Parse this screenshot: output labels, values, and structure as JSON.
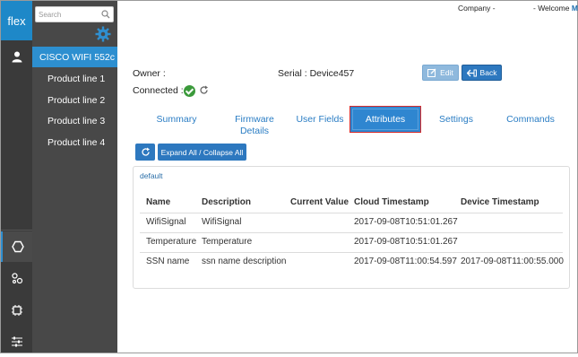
{
  "rail": {
    "logo": "flex",
    "items": [
      "user-icon",
      "hexagon-icon",
      "cog-network-icon",
      "chip-icon",
      "sliders-icon"
    ]
  },
  "sidebar": {
    "search_placeholder": "Search",
    "device": "CISCO WIFI 552c",
    "product_lines": [
      "Product line 1",
      "Product line 2",
      "Product line 3",
      "Product line 4"
    ]
  },
  "header": {
    "company": "Company -",
    "welcome": "- Welcome",
    "welcome_initial": "M"
  },
  "device": {
    "owner_label": "Owner :",
    "serial_label": "Serial : Device457",
    "connected_label": "Connected :",
    "edit_label": "Edit",
    "back_label": "Back"
  },
  "tabs": {
    "summary": "Summary",
    "firmware_line1": "Firmware",
    "firmware_line2": "Details",
    "user_fields": "User Fields",
    "attributes": "Attributes",
    "settings": "Settings",
    "commands": "Commands",
    "active": "Attributes"
  },
  "toolbar": {
    "expand_label": "Expand All / Collapse All"
  },
  "panel": {
    "title": "default",
    "columns": [
      "Name",
      "Description",
      "Current Value",
      "Cloud Timestamp",
      "Device Timestamp"
    ],
    "rows": [
      {
        "name": "WifiSignal",
        "description": "WifiSignal",
        "current": "",
        "cloud": "2017-09-08T10:51:01.267",
        "device": ""
      },
      {
        "name": "Temperature",
        "description": "Temperature",
        "current": "",
        "cloud": "2017-09-08T10:51:01.267",
        "device": ""
      },
      {
        "name": "SSN name",
        "description": "ssn name description",
        "current": "",
        "cloud": "2017-09-08T11:00:54.597",
        "device": "2017-09-08T11:00:55.000"
      }
    ]
  },
  "colors": {
    "accent": "#2d78bf",
    "rail_bg": "#3a3a3a",
    "sidebar_bg": "#484848",
    "active_tab_border": "#d62c2c",
    "connected": "#3b9a3b"
  }
}
